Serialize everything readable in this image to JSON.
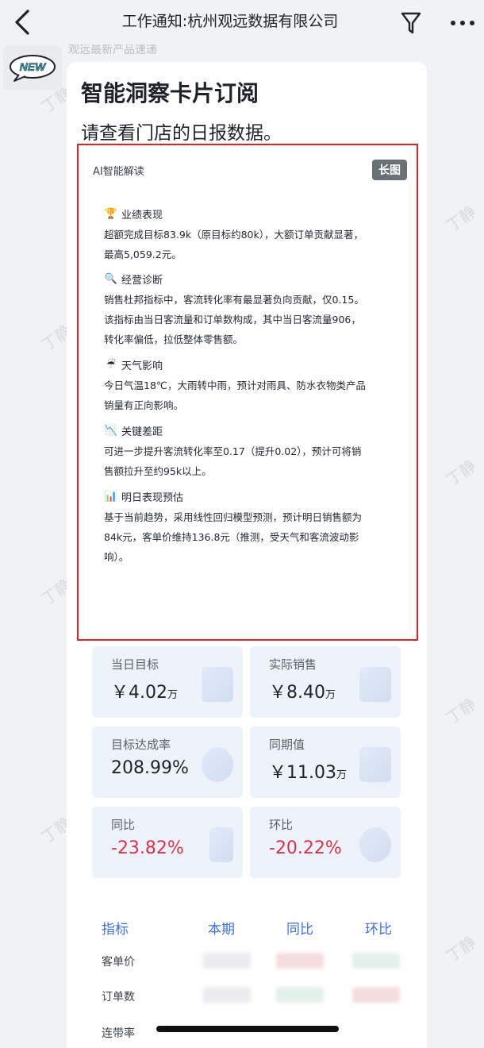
{
  "header": {
    "title": "工作通知:杭州观远数据有限公司",
    "back_icon": "chevron-left-icon",
    "filter_icon": "filter-icon",
    "more_icon": "more-horizontal-icon"
  },
  "avatar": {
    "badge": "NEW"
  },
  "faded_preview": "观远最新产品速递",
  "watermark": "丁静",
  "card": {
    "title": "智能洞察卡片订阅",
    "subtitle": "请查看门店的日报数据。"
  },
  "ai_image": {
    "label": "AI智能解读",
    "badge": "长图",
    "sections": [
      {
        "icon": "trophy-icon",
        "glyph": "🏆",
        "title": "业绩表现",
        "lines": [
          "超额完成目标83.9k（原目标约80k），大额订单贡献显著，",
          "最高5,059.2元。"
        ]
      },
      {
        "icon": "magnifier-icon",
        "glyph": "🔍",
        "title": "经营诊断",
        "lines": [
          "销售杜邦指标中，客流转化率有最显著负向贡献，仅0.15。",
          "该指标由当日客流量和订单数构成，其中当日客流量906，",
          "转化率偏低，拉低整体零售额。"
        ]
      },
      {
        "icon": "umbrella-icon",
        "glyph": "☔",
        "title": "天气影响",
        "lines": [
          "今日气温18℃，大雨转中雨，预计对雨具、防水衣物类产品",
          "销量有正向影响。"
        ]
      },
      {
        "icon": "trend-down-icon",
        "glyph": "📉",
        "title": "关键差距",
        "lines": [
          "可进一步提升客流转化率至0.17（提升0.02），预计可将销",
          "售额拉升至约95k以上。"
        ]
      },
      {
        "icon": "bar-chart-icon",
        "glyph": "📊",
        "title": "明日表现预估",
        "lines": [
          "基于当前趋势，采用线性回归模型预测，预计明日销售额为",
          "84k元，客单价维持136.8元（推测，受天气和客流波动影",
          "响）。"
        ]
      }
    ]
  },
  "kpis": [
    {
      "label": "当日目标",
      "value": "￥4.02",
      "unit": "万",
      "negative": false,
      "icon": "monitor-icon"
    },
    {
      "label": "实际销售",
      "value": "￥8.40",
      "unit": "万",
      "negative": false,
      "icon": "document-icon"
    },
    {
      "label": "目标达成率",
      "value": "208.99%",
      "unit": "",
      "negative": false,
      "icon": "badge-icon"
    },
    {
      "label": "同期值",
      "value": "￥11.03",
      "unit": "万",
      "negative": false,
      "icon": "box-icon"
    },
    {
      "label": "同比",
      "value": "-23.82%",
      "unit": "",
      "negative": true,
      "icon": "bars-icon"
    },
    {
      "label": "环比",
      "value": "-20.22%",
      "unit": "",
      "negative": true,
      "icon": "play-circle-icon"
    }
  ],
  "table": {
    "headers": [
      "指标",
      "本期",
      "同比",
      "环比"
    ],
    "rows": [
      "客单价",
      "订单数",
      "连带率"
    ]
  }
}
